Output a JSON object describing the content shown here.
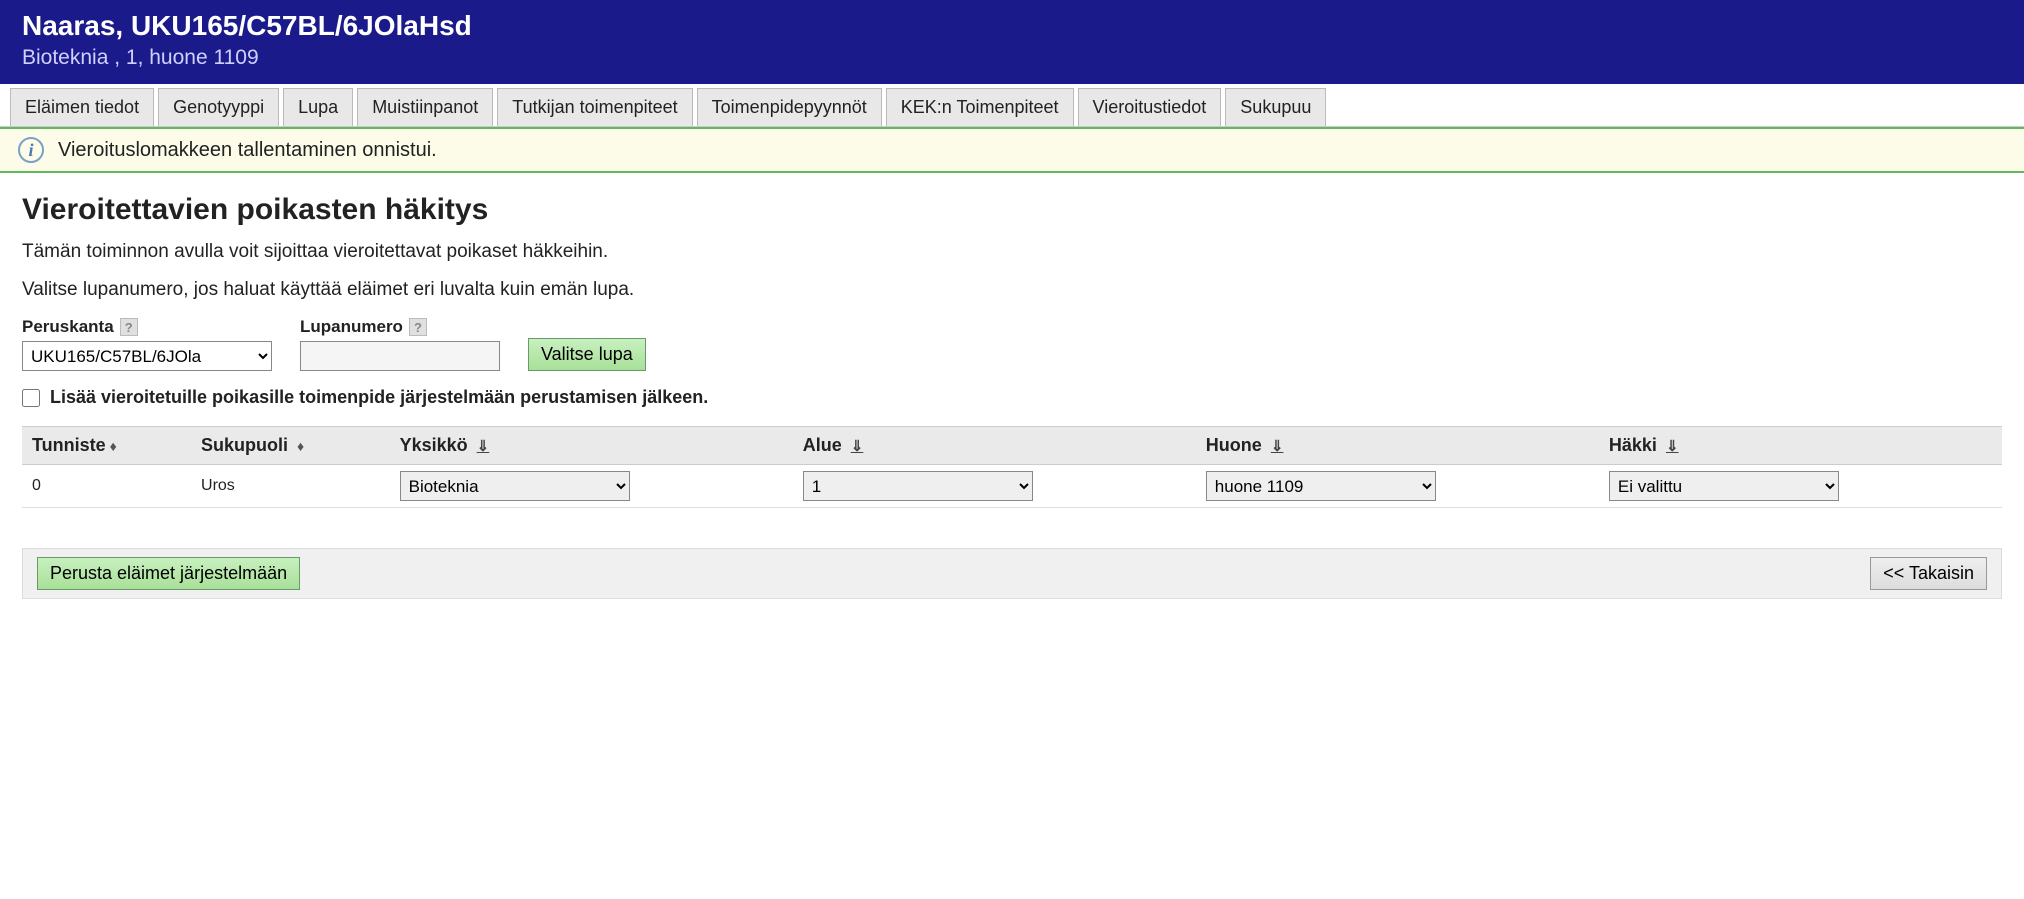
{
  "header": {
    "title": "Naaras, UKU165/C57BL/6JOlaHsd",
    "subtitle": "Bioteknia , 1, huone 1109"
  },
  "tabs": [
    "Eläimen tiedot",
    "Genotyyppi",
    "Lupa",
    "Muistiinpanot",
    "Tutkijan toimenpiteet",
    "Toimenpidepyynnöt",
    "KEK:n Toimenpiteet",
    "Vieroitustiedot",
    "Sukupuu"
  ],
  "info_message": "Vieroituslomakkeen tallentaminen onnistui.",
  "section": {
    "title": "Vieroitettavien poikasten häkitys",
    "desc1": "Tämän toiminnon avulla voit sijoittaa vieroitettavat poikaset häkkeihin.",
    "desc2": "Valitse lupanumero, jos haluat käyttää eläimet eri luvalta kuin emän lupa."
  },
  "form": {
    "peruskanta_label": "Peruskanta",
    "peruskanta_value": "UKU165/C57BL/6JOla",
    "lupanumero_label": "Lupanumero",
    "lupanumero_value": "",
    "valitse_lupa_btn": "Valitse lupa",
    "checkbox_label": "Lisää vieroitetuille poikasille toimenpide järjestelmään perustamisen jälkeen."
  },
  "table": {
    "headers": {
      "tunniste": "Tunniste",
      "sukupuoli": "Sukupuoli",
      "yksikko": "Yksikkö",
      "alue": "Alue",
      "huone": "Huone",
      "hakki": "Häkki"
    },
    "rows": [
      {
        "tunniste": "0",
        "sukupuoli": "Uros",
        "yksikko": "Bioteknia",
        "alue": "1",
        "huone": "huone 1109",
        "hakki": "Ei valittu"
      }
    ]
  },
  "footer": {
    "perusta_btn": "Perusta eläimet järjestelmään",
    "back_btn": "<< Takaisin"
  }
}
